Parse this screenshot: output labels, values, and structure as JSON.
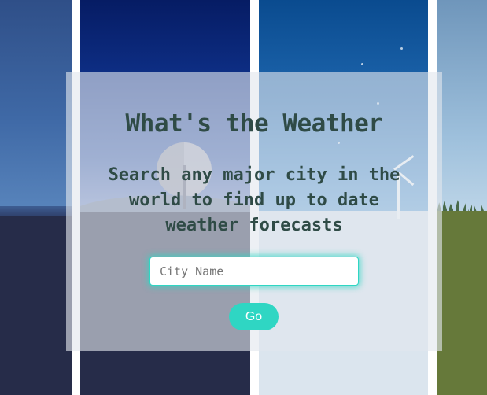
{
  "hero": {
    "title": "What's the Weather",
    "subtitle": "Search any major city in the world to find up to date weather forecasts"
  },
  "search": {
    "placeholder": "City Name",
    "value": "",
    "button_label": "Go"
  },
  "colors": {
    "accent": "#2fd6c3",
    "heading_text": "#2f4b46"
  }
}
